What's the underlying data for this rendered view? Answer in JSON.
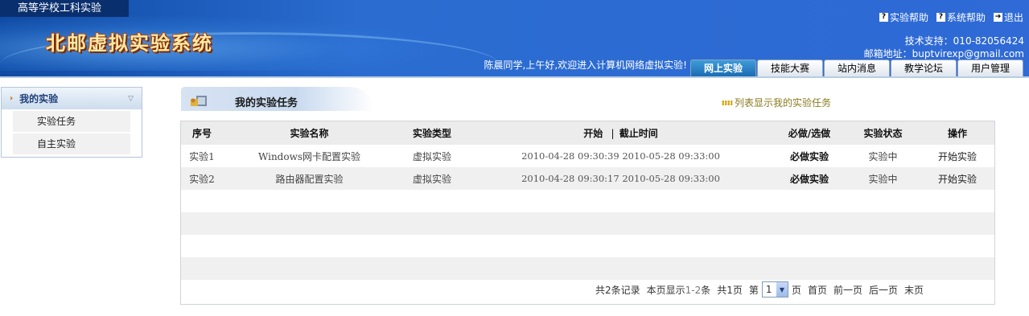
{
  "header": {
    "school_title": "高等学校工科实验",
    "system_title": "北邮虚拟实验系统",
    "top_links": [
      {
        "label": "实验帮助",
        "icon": "help-icon"
      },
      {
        "label": "系统帮助",
        "icon": "help-icon"
      },
      {
        "label": "退出",
        "icon": "exit-icon"
      }
    ],
    "support": "技术支持：010-82056424",
    "email": "邮箱地址：buptvirexp@gmail.com",
    "welcome": "陈晨同学,上午好,欢迎进入计算机网络虚拟实验!",
    "tabs": [
      {
        "label": "网上实验",
        "active": true
      },
      {
        "label": "技能大赛",
        "active": false
      },
      {
        "label": "站内消息",
        "active": false
      },
      {
        "label": "教学论坛",
        "active": false
      },
      {
        "label": "用户管理",
        "active": false
      }
    ]
  },
  "sidebar": {
    "title": "我的实验",
    "items": [
      {
        "label": "实验任务"
      },
      {
        "label": "自主实验"
      }
    ]
  },
  "main": {
    "title": "我的实验任务",
    "list_link": "列表显示我的实验任务",
    "columns": {
      "index": "序号",
      "name": "实验名称",
      "type": "实验类型",
      "time_start": "开始",
      "time_sep": "|",
      "time_end": "截止时间",
      "required": "必做/选做",
      "status": "实验状态",
      "action": "操作"
    },
    "rows": [
      {
        "index": "实验1",
        "name": "Windows网卡配置实验",
        "type": "虚拟实验",
        "time": "2010-04-28 09:30:39  2010-05-28 09:33:00",
        "required": "必做实验",
        "status": "实验中",
        "action": "开始实验"
      },
      {
        "index": "实验2",
        "name": "路由器配置实验",
        "type": "虚拟实验",
        "time": "2010-04-28 09:30:17  2010-05-28 09:33:00",
        "required": "必做实验",
        "status": "实验中",
        "action": "开始实验"
      }
    ],
    "empty_rows": 4,
    "pager": {
      "total": "共2条记录",
      "showing_prefix": "本页显示",
      "showing_range": "1-2",
      "showing_suffix": "条",
      "pages": "共1页",
      "page_prefix": "第",
      "current_page": "1",
      "page_suffix": "页",
      "first": "首页",
      "prev": "前一页",
      "next": "后一页",
      "last": "末页"
    }
  },
  "colors": {
    "header_blue": "#2f6ad6",
    "active_tab": "#1b6cb4",
    "logo_text": "#ffe9a8"
  }
}
